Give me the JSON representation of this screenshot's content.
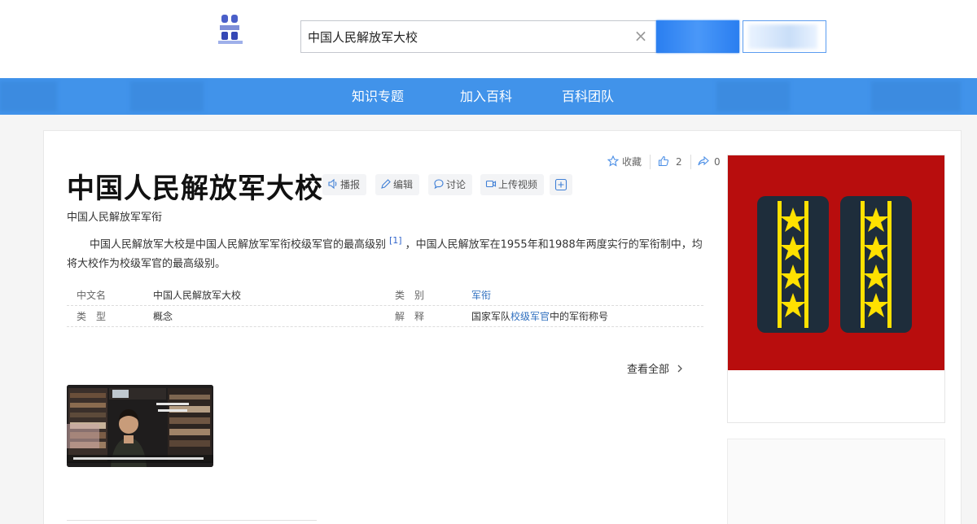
{
  "header": {
    "search_value": "中国人民解放军大校",
    "clear_symbol": "×"
  },
  "nav": {
    "items": [
      "知识专题",
      "加入百科",
      "百科团队"
    ]
  },
  "actions": {
    "favorite_label": "收藏",
    "like_count": "2",
    "share_count": "0"
  },
  "article": {
    "title": "中国人民解放军大校",
    "subtitle": "中国人民解放军军衔",
    "tools": {
      "broadcast": "播报",
      "edit": "编辑",
      "discuss": "讨论",
      "upload_video": "上传视频"
    },
    "summary": {
      "part1": "中国人民解放军大校是中国人民解放军军衔校级军官的最高级别",
      "ref": "[1]",
      "part2": "，中国人民解放军在1955年和1988年两度实行的军衔制中，均将大校作为校级军官的最高级别。"
    },
    "infobox": {
      "row1": {
        "label_left": "中文名",
        "value_left": "中国人民解放军大校",
        "label_right": "类　别",
        "value_right": "军衔"
      },
      "row2": {
        "label_left": "类　型",
        "value_left": "概念",
        "label_right": "解　释",
        "value_right_prefix": "国家军队",
        "value_right_link": "校级军官",
        "value_right_suffix": "中的军衔称号"
      }
    },
    "view_all": "查看全部"
  },
  "colors": {
    "nav_bg": "#4193ea",
    "link": "#2f6fbf",
    "insignia_bg": "#b80d0d",
    "insignia_star": "#ffe100"
  }
}
